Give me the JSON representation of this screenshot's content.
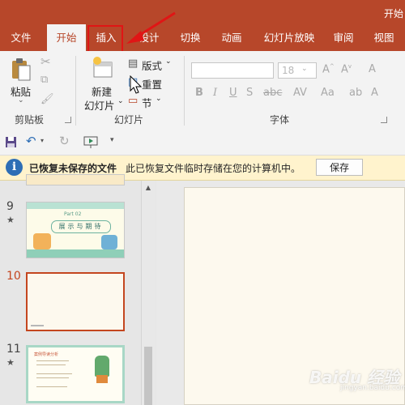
{
  "window": {
    "title": "开始"
  },
  "tabs": [
    {
      "label": "文件"
    },
    {
      "label": "开始"
    },
    {
      "label": "插入"
    },
    {
      "label": "设计"
    },
    {
      "label": "切换"
    },
    {
      "label": "动画"
    },
    {
      "label": "幻灯片放映"
    },
    {
      "label": "审阅"
    },
    {
      "label": "视图"
    }
  ],
  "active_tab": "开始",
  "highlighted_tab": "插入",
  "ribbon": {
    "clipboard": {
      "paste": "粘贴",
      "group": "剪贴板"
    },
    "slides": {
      "new_slide_line1": "新建",
      "new_slide_line2": "幻灯片",
      "layout": "版式",
      "reset": "重置",
      "section": "节",
      "group": "幻灯片"
    },
    "font": {
      "size_value": "18",
      "group": "字体"
    }
  },
  "info_bar": {
    "icon": "info-icon",
    "title": "已恢复未保存的文件",
    "message": "此已恢复文件临时存储在您的计算机中。",
    "save_button": "保存"
  },
  "slides": [
    {
      "number": "9",
      "star": "★",
      "thumb_title": "Part 02",
      "thumb_text": "展示与期待"
    },
    {
      "number": "10",
      "selected": true
    },
    {
      "number": "11",
      "star": "★",
      "thumb_title": "案例导读分析"
    }
  ],
  "watermark": "Baidu 经验",
  "watermark_sub": "jingyan.baidu.com",
  "colors": {
    "brand": "#b7472a",
    "highlight": "#e01515",
    "infobar": "#fff3cd"
  }
}
